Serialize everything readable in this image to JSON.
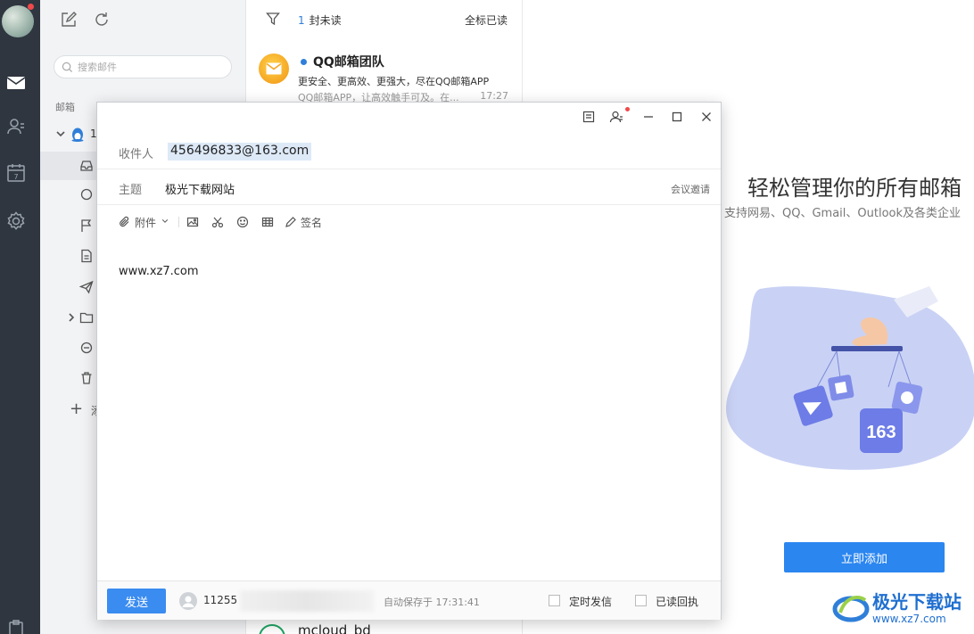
{
  "sidebar": {
    "search_placeholder": "搜索邮件",
    "section_label": "邮箱",
    "account_label": "1",
    "add_label": "添"
  },
  "message_list": {
    "unread_count": "1",
    "unread_suffix": "封未读",
    "mark_all_read": "全标已读",
    "items": [
      {
        "sender": "QQ邮箱团队",
        "subject": "更安全、更高效、更强大，尽在QQ邮箱APP",
        "preview": "QQ邮箱APP，让高效触手可及。在...",
        "time": "17:27"
      },
      {
        "sender": "mcloud_bd"
      }
    ]
  },
  "compose": {
    "to_label": "收件人",
    "to_value": "456496833@163.com",
    "subject_label": "主题",
    "subject_value": "极光下载网站",
    "meeting_invite": "会议邀请",
    "toolbar": {
      "attach": "附件",
      "signature": "签名"
    },
    "body": "www.xz7.com",
    "send": "发送",
    "sender_account": "11255",
    "autosave": "自动保存于 17:31:41",
    "scheduled_send": "定时发信",
    "read_receipt": "已读回执"
  },
  "right_pane": {
    "title": "轻松管理你的所有邮箱",
    "subtitle": "支持网易、QQ、Gmail、Outlook及各类企业",
    "add_now": "立即添加",
    "illustration_badge": "163"
  },
  "watermark": {
    "name": "极光下载站",
    "url": "www.xz7.com"
  },
  "colors": {
    "rail": "#2f3640",
    "accent": "#2b86f0",
    "unread_dot": "#2f7fd9"
  }
}
